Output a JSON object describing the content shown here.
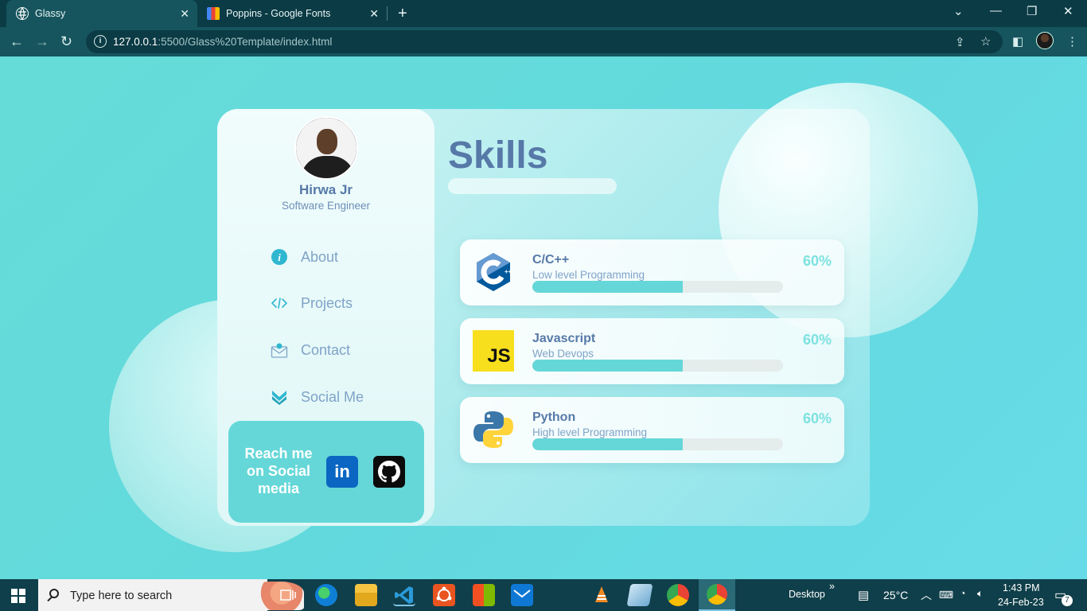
{
  "browser": {
    "tabs": [
      {
        "title": "Glassy",
        "active": true
      },
      {
        "title": "Poppins - Google Fonts",
        "active": false
      }
    ],
    "new_tab_label": "+",
    "address": {
      "host": "127.0.0.1",
      "rest": ":5500/Glass%20Template/index.html"
    }
  },
  "profile": {
    "name": "Hirwa Jr",
    "role": "Software Engineer"
  },
  "menu": [
    {
      "label": "About",
      "icon": "info-icon"
    },
    {
      "label": "Projects",
      "icon": "code-icon"
    },
    {
      "label": "Contact",
      "icon": "mail-icon"
    },
    {
      "label": "Social Me",
      "icon": "chevrons-down-icon"
    }
  ],
  "social": {
    "text_line1": "Reach me",
    "text_line2": "on Social",
    "text_line3": "media",
    "linkedin_label": "in"
  },
  "skills": {
    "title": "Skills",
    "items": [
      {
        "name": "C/C++",
        "desc": "Low level Programming",
        "percent_label": "60%",
        "progress": 0.6,
        "icon": "cpp-logo-icon"
      },
      {
        "name": "Javascript",
        "desc": "Web Devops",
        "percent_label": "60%",
        "progress": 0.6,
        "icon": "js-logo-icon",
        "logo_text": "JS"
      },
      {
        "name": "Python",
        "desc": "High level Programming",
        "percent_label": "60%",
        "progress": 0.6,
        "icon": "python-logo-icon"
      }
    ]
  },
  "taskbar": {
    "search_placeholder": "Type here to search",
    "desktop_label": "Desktop",
    "weather": "25°C",
    "time": "1:43 PM",
    "date": "24-Feb-23",
    "notification_count": "7"
  },
  "colors": {
    "accent": "#66d7d8",
    "text_primary": "#5679a8",
    "text_secondary": "#7fa3c8"
  }
}
